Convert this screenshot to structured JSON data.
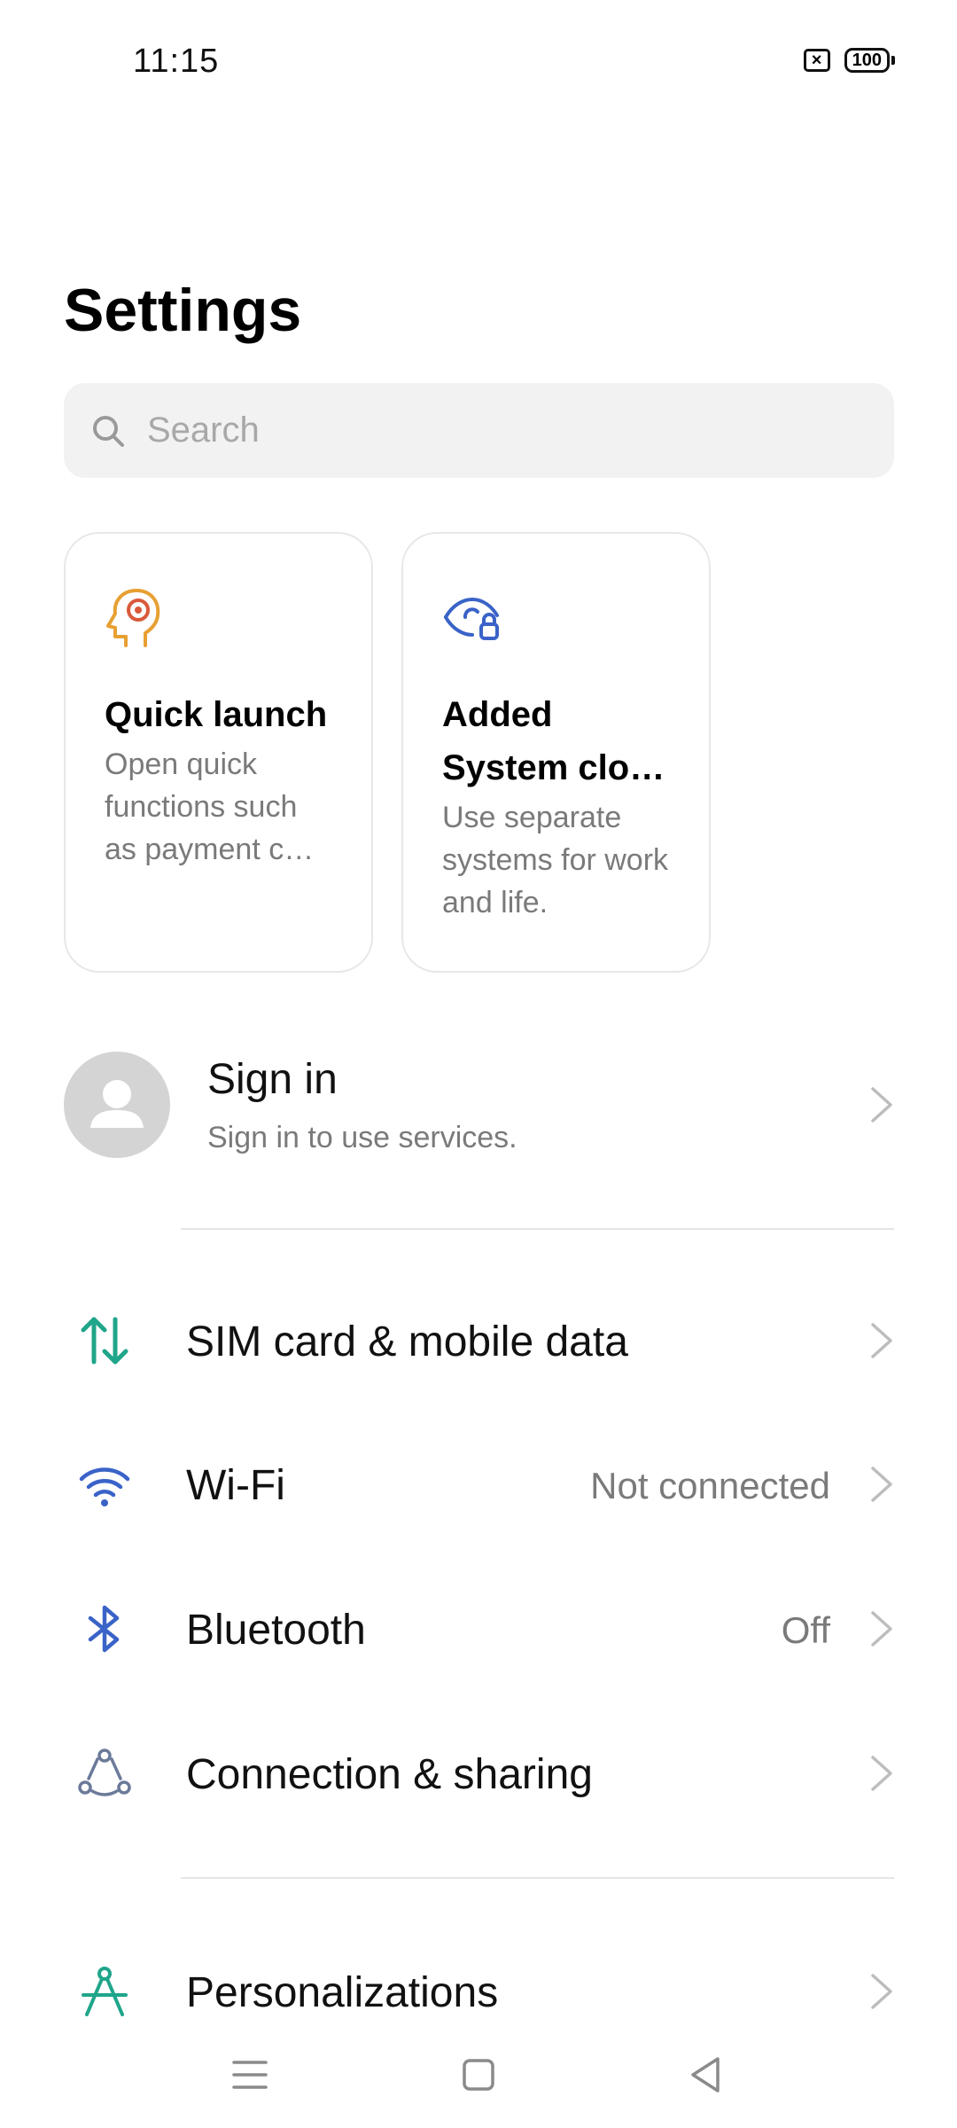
{
  "status_bar": {
    "time": "11:15",
    "sim_icon": "no-sim-icon",
    "battery_level": "100"
  },
  "page": {
    "title": "Settings"
  },
  "search": {
    "placeholder": "Search"
  },
  "cards": [
    {
      "icon": "quick-launch-head-icon",
      "title": "Quick launch",
      "description": "Open quick functions such as payment c…"
    },
    {
      "icon": "eye-lock-icon",
      "title": "Added System clo…",
      "description": "Use separate systems for work and life."
    }
  ],
  "account": {
    "title": "Sign in",
    "subtitle": "Sign in to use services."
  },
  "settings_items": [
    {
      "label": "SIM card & mobile data",
      "value": "",
      "icon": "sim-data-arrows-icon"
    },
    {
      "label": "Wi-Fi",
      "value": "Not connected",
      "icon": "wifi-icon"
    },
    {
      "label": "Bluetooth",
      "value": "Off",
      "icon": "bluetooth-icon"
    },
    {
      "label": "Connection & sharing",
      "value": "",
      "icon": "connection-sharing-icon"
    },
    {
      "label": "Personalizations",
      "value": "",
      "icon": "personalization-compass-icon"
    }
  ],
  "colors": {
    "teal": "#1fa58a",
    "blue": "#3a63c8",
    "orange": "#e8a033",
    "gray_text": "#7a7a7a"
  },
  "nav_bar": {
    "buttons": [
      "menu-icon",
      "home-icon",
      "back-icon"
    ]
  }
}
